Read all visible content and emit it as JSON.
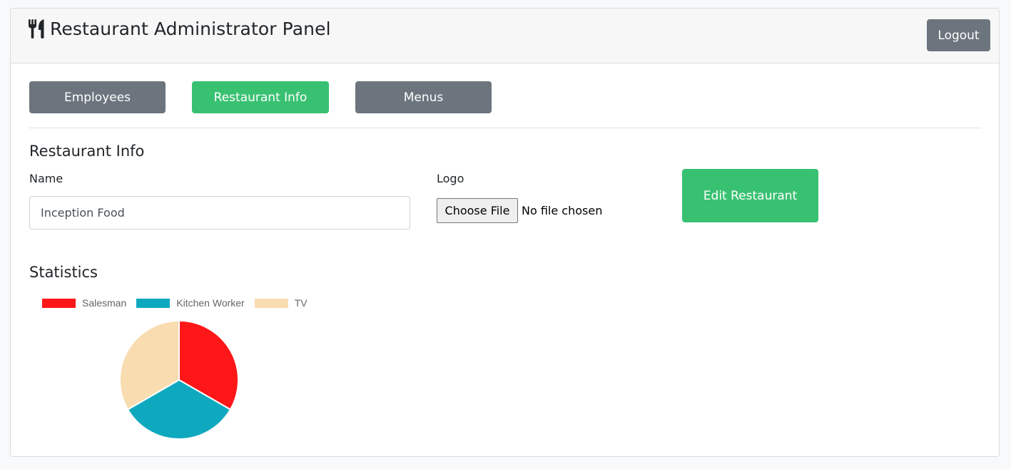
{
  "header": {
    "icon": "utensils-icon",
    "title": "Restaurant Administrator Panel",
    "logout_label": "Logout"
  },
  "nav": {
    "tabs": [
      {
        "label": "Employees",
        "active": false
      },
      {
        "label": "Restaurant Info",
        "active": true
      },
      {
        "label": "Menus",
        "active": false
      }
    ]
  },
  "restaurant_info": {
    "title": "Restaurant Info",
    "name_label": "Name",
    "name_value": "Inception Food",
    "logo_label": "Logo",
    "file_button_label": "Choose File",
    "file_status": "No file chosen",
    "edit_button_label": "Edit Restaurant"
  },
  "statistics": {
    "title": "Statistics"
  },
  "colors": {
    "accent_green": "#39c172",
    "secondary_gray": "#6c757d"
  },
  "chart_data": {
    "type": "pie",
    "categories": [
      "Salesman",
      "Kitchen Worker",
      "TV"
    ],
    "values": [
      1,
      1,
      1
    ],
    "colors": [
      "#fe1719",
      "#0fa9bf",
      "#f9dcb0"
    ],
    "legend": "top"
  }
}
